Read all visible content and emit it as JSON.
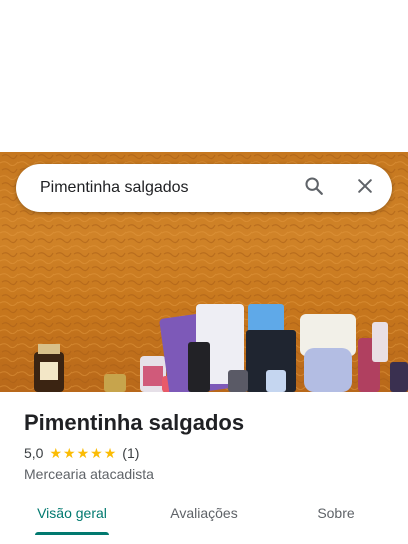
{
  "search": {
    "query": "Pimentinha salgados",
    "search_icon": "search-icon",
    "clear_icon": "close-icon"
  },
  "place": {
    "name": "Pimentinha salgados",
    "rating": "5,0",
    "stars": 5,
    "review_count": "(1)",
    "category": "Mercearia atacadista"
  },
  "tabs": [
    {
      "label": "Visão geral",
      "active": true
    },
    {
      "label": "Avaliações",
      "active": false
    },
    {
      "label": "Sobre",
      "active": false
    }
  ],
  "colors": {
    "accent": "#01796f",
    "star": "#fbbc04"
  }
}
